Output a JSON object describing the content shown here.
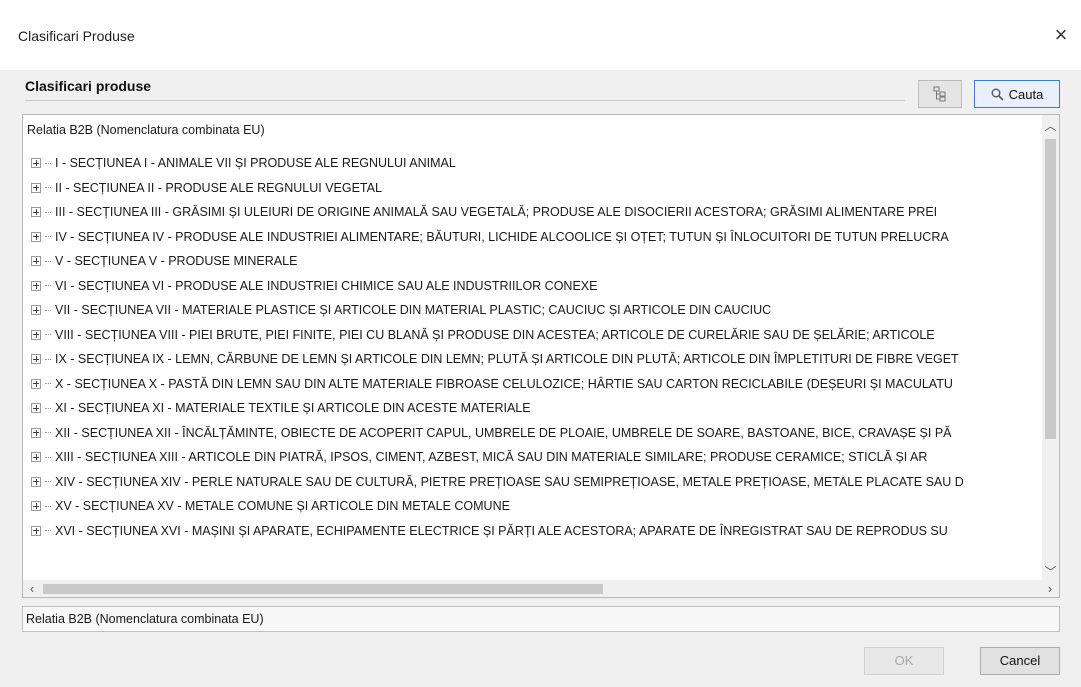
{
  "window": {
    "title": "Clasificari Produse",
    "close": "×"
  },
  "panel": {
    "title": "Clasificari produse"
  },
  "toolbar": {
    "search_label": "Cauta"
  },
  "tree": {
    "root": "Relatia B2B (Nomenclatura combinata EU)",
    "items": [
      "I - SECȚIUNEA I - ANIMALE VII ȘI PRODUSE ALE REGNULUI ANIMAL",
      "II - SECȚIUNEA II - PRODUSE ALE REGNULUI VEGETAL",
      "III - SECȚIUNEA III - GRĂSIMI ȘI ULEIURI DE ORIGINE ANIMALĂ SAU VEGETALĂ; PRODUSE ALE DISOCIERII ACESTORA; GRĂSIMI ALIMENTARE PREI",
      "IV - SECȚIUNEA IV - PRODUSE ALE INDUSTRIEI ALIMENTARE; BĂUTURI, LICHIDE ALCOOLICE ȘI OȚET; TUTUN ȘI ÎNLOCUITORI DE TUTUN PRELUCRA",
      "V - SECȚIUNEA V - PRODUSE MINERALE",
      "VI - SECȚIUNEA VI - PRODUSE ALE INDUSTRIEI CHIMICE SAU ALE INDUSTRIILOR CONEXE",
      "VII - SECȚIUNEA VII - MATERIALE PLASTICE ȘI ARTICOLE DIN MATERIAL PLASTIC; CAUCIUC ȘI ARTICOLE DIN CAUCIUC",
      "VIII - SECȚIUNEA VIII - PIEI BRUTE, PIEI FINITE, PIEI CU BLANĂ ȘI PRODUSE DIN ACESTEA; ARTICOLE DE CURELĂRIE SAU DE ȘELĂRIE; ARTICOLE",
      "IX - SECȚIUNEA IX - LEMN, CĂRBUNE DE LEMN ȘI ARTICOLE DIN LEMN; PLUTĂ ȘI ARTICOLE DIN PLUTĂ; ARTICOLE DIN ÎMPLETITURI DE FIBRE VEGET",
      "X - SECȚIUNEA X - PASTĂ DIN LEMN SAU DIN ALTE MATERIALE FIBROASE CELULOZICE; HÂRTIE SAU CARTON RECICLABILE (DEȘEURI ȘI MACULATU",
      "XI - SECȚIUNEA XI - MATERIALE TEXTILE ȘI ARTICOLE DIN ACESTE MATERIALE",
      "XII - SECȚIUNEA XII - ÎNCĂLȚĂMINTE, OBIECTE DE ACOPERIT CAPUL, UMBRELE DE PLOAIE, UMBRELE DE SOARE, BASTOANE, BICE, CRAVAȘE ȘI PĂ",
      "XIII - SECȚIUNEA XIII - ARTICOLE DIN PIATRĂ, IPSOS, CIMENT, AZBEST, MICĂ SAU DIN MATERIALE SIMILARE; PRODUSE CERAMICE; STICLĂ ȘI AR",
      "XIV - SECȚIUNEA XIV - PERLE NATURALE SAU DE CULTURĂ, PIETRE PREȚIOASE SAU SEMIPREȚIOASE, METALE PREȚIOASE, METALE PLACATE SAU D",
      "XV - SECȚIUNEA XV - METALE COMUNE ȘI ARTICOLE DIN METALE COMUNE",
      "XVI - SECȚIUNEA XVI - MAȘINI ȘI APARATE, ECHIPAMENTE ELECTRICE ȘI PĂRȚI ALE ACESTORA; APARATE DE ÎNREGISTRAT SAU DE REPRODUS SU"
    ]
  },
  "status": {
    "text": "Relatia B2B (Nomenclatura combinata EU)"
  },
  "footer": {
    "ok_label": "OK",
    "cancel_label": "Cancel"
  }
}
